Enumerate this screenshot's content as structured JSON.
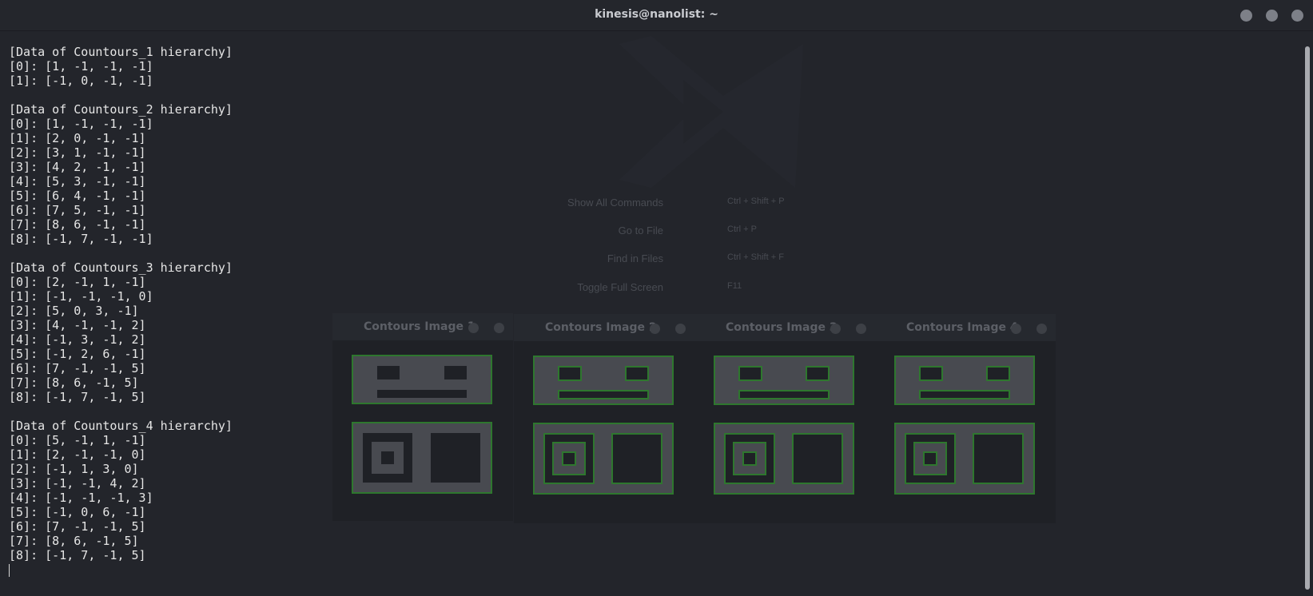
{
  "window": {
    "title": "kinesis@nanolist: ~"
  },
  "terminal": {
    "lines": [
      "[Data of Countours_1 hierarchy]",
      "[0]: [1, -1, -1, -1]",
      "[1]: [-1, 0, -1, -1]",
      "",
      "[Data of Countours_2 hierarchy]",
      "[0]: [1, -1, -1, -1]",
      "[1]: [2, 0, -1, -1]",
      "[2]: [3, 1, -1, -1]",
      "[3]: [4, 2, -1, -1]",
      "[4]: [5, 3, -1, -1]",
      "[5]: [6, 4, -1, -1]",
      "[6]: [7, 5, -1, -1]",
      "[7]: [8, 6, -1, -1]",
      "[8]: [-1, 7, -1, -1]",
      "",
      "[Data of Countours_3 hierarchy]",
      "[0]: [2, -1, 1, -1]",
      "[1]: [-1, -1, -1, 0]",
      "[2]: [5, 0, 3, -1]",
      "[3]: [4, -1, -1, 2]",
      "[4]: [-1, 3, -1, 2]",
      "[5]: [-1, 2, 6, -1]",
      "[6]: [7, -1, -1, 5]",
      "[7]: [8, 6, -1, 5]",
      "[8]: [-1, 7, -1, 5]",
      "",
      "[Data of Countours_4 hierarchy]",
      "[0]: [5, -1, 1, -1]",
      "[1]: [2, -1, -1, 0]",
      "[2]: [-1, 1, 3, 0]",
      "[3]: [-1, -1, 4, 2]",
      "[4]: [-1, -1, -1, 3]",
      "[5]: [-1, 0, 6, -1]",
      "[6]: [7, -1, -1, 5]",
      "[7]: [8, 6, -1, 5]",
      "[8]: [-1, 7, -1, 5]"
    ]
  },
  "background_hints": {
    "commands": [
      {
        "label": "Show All Commands",
        "keys": "Ctrl + Shift + P"
      },
      {
        "label": "Go to File",
        "keys": "Ctrl + P"
      },
      {
        "label": "Find in Files",
        "keys": "Ctrl + Shift + F"
      },
      {
        "label": "Toggle Full Screen",
        "keys": "F11"
      }
    ]
  },
  "contour_windows": [
    {
      "title": "Contours Image 1"
    },
    {
      "title": "Contours Image 2"
    },
    {
      "title": "Contours Image 3"
    },
    {
      "title": "Contours Image 4"
    }
  ],
  "colors": {
    "terminal_bg": "#23252b",
    "terminal_fg": "#e6e6e6",
    "contour_green": "#2f7a2f",
    "shape_gray": "#4a4c52",
    "shape_dark": "#1f2126"
  },
  "icons": {
    "window_close": "circle-button",
    "window_maximize": "circle-button",
    "window_minimize": "circle-button"
  }
}
